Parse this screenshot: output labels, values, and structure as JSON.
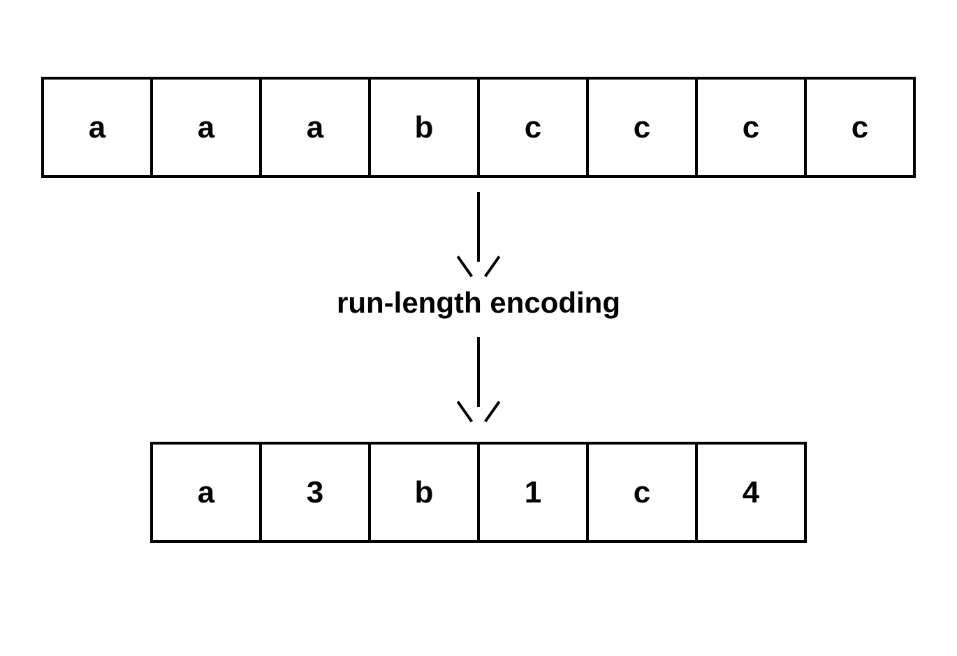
{
  "diagram": {
    "input_row": [
      "a",
      "a",
      "a",
      "b",
      "c",
      "c",
      "c",
      "c"
    ],
    "label": "run-length encoding",
    "output_row": [
      "a",
      "3",
      "b",
      "1",
      "c",
      "4"
    ]
  }
}
